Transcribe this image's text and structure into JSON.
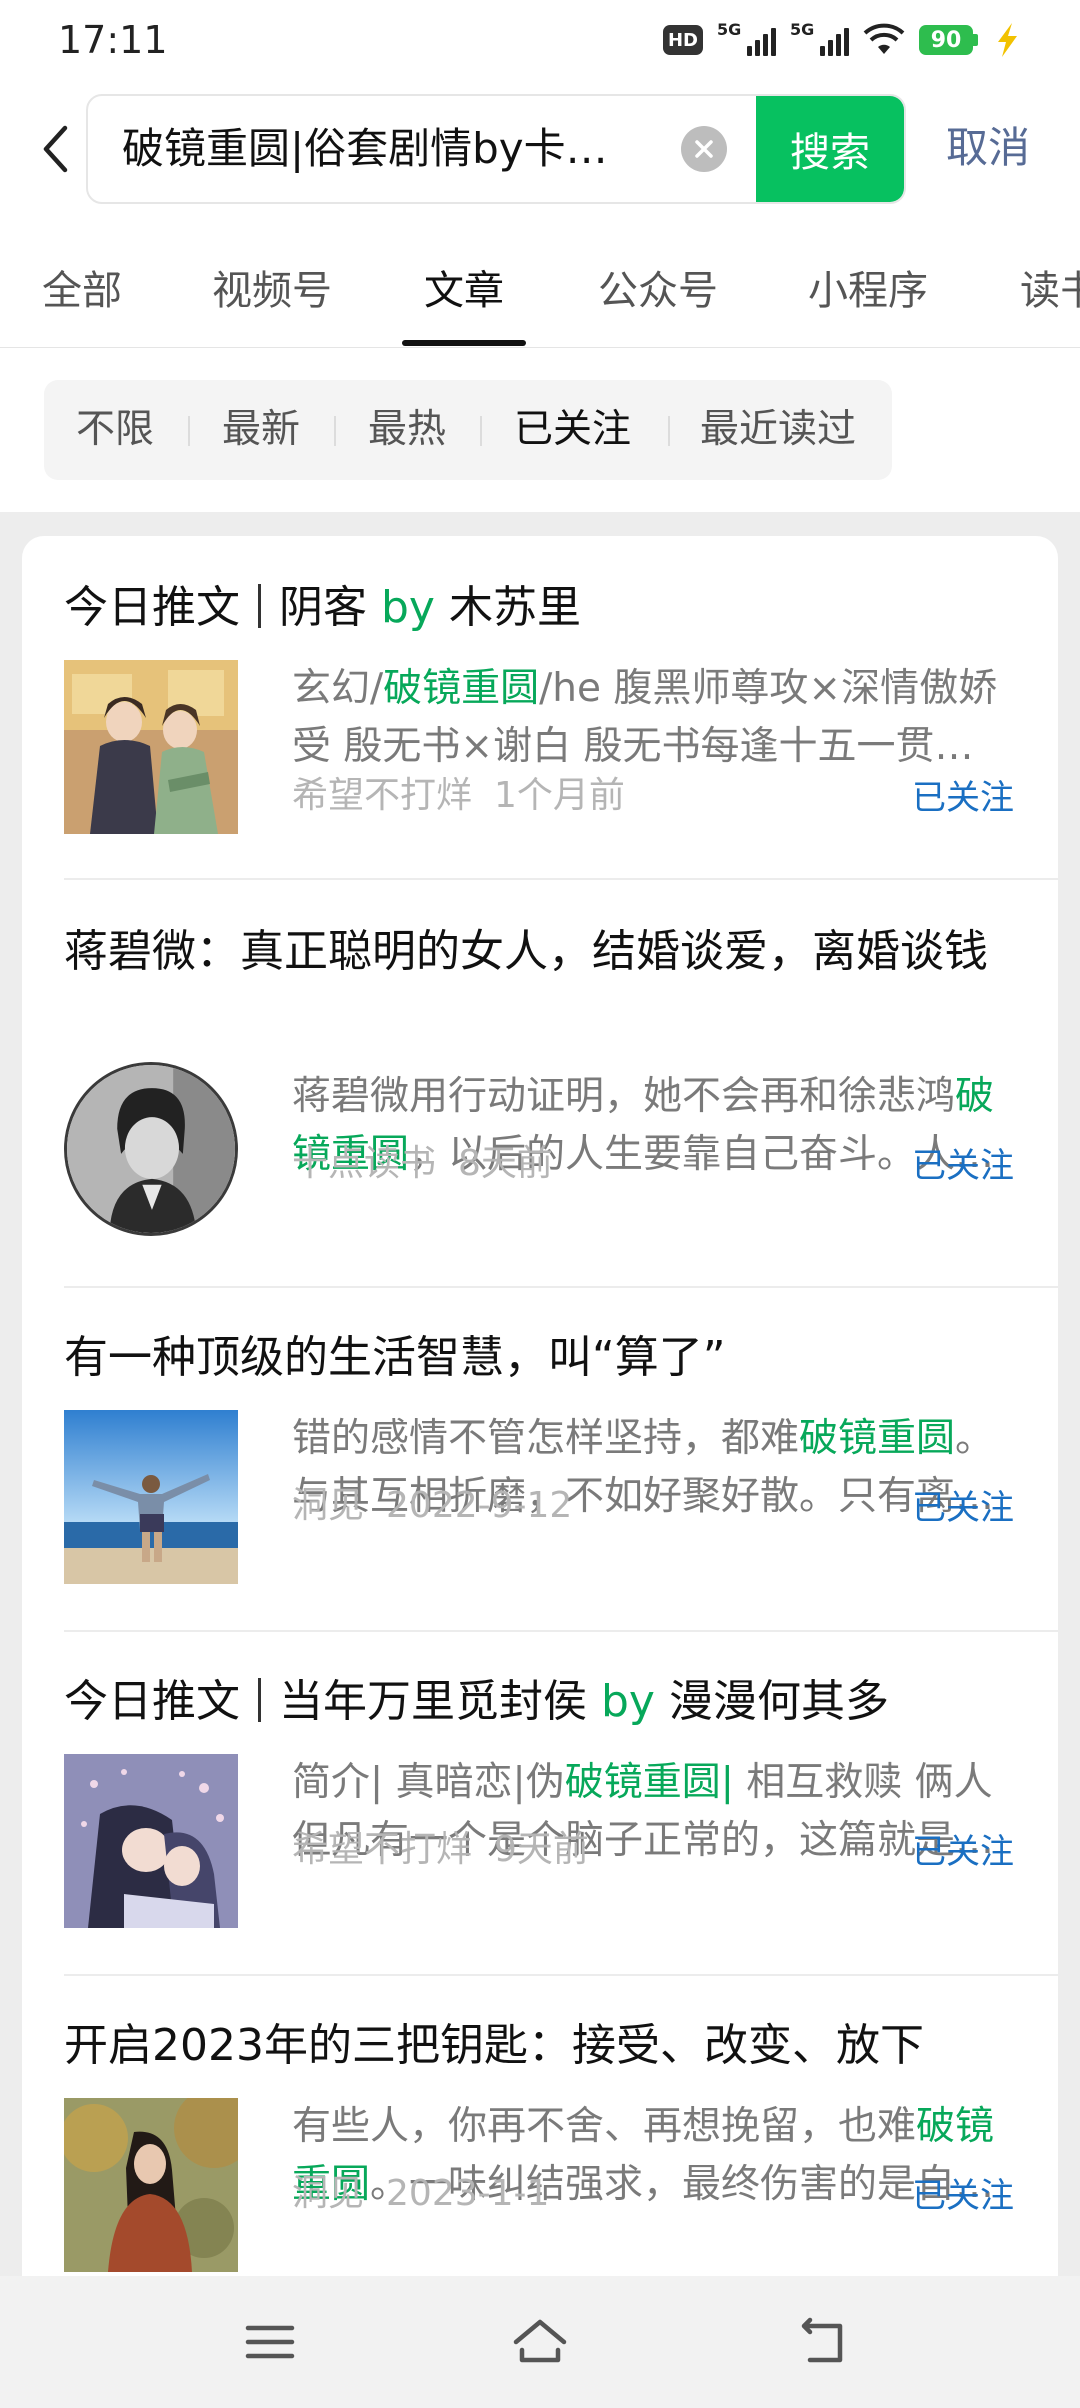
{
  "status_bar": {
    "time": "17:11",
    "network_badge": "HD",
    "sim1_label": "5G",
    "sim2_label": "5G",
    "battery": "90",
    "battery_color": "#2ebd4e",
    "icons": [
      "hd-icon",
      "signal-icon",
      "signal-icon",
      "wifi-icon",
      "battery-icon",
      "charging-bolt-icon"
    ]
  },
  "search": {
    "query": "破镜重圆|俗套剧情by卡…",
    "search_button": "搜索",
    "cancel": "取消",
    "accent": "#07c160",
    "link_color": "#576b95"
  },
  "tabs": [
    {
      "label": "全部"
    },
    {
      "label": "视频号"
    },
    {
      "label": "文章",
      "active": true
    },
    {
      "label": "公众号"
    },
    {
      "label": "小程序"
    },
    {
      "label": "读书"
    }
  ],
  "filters": [
    {
      "label": "不限"
    },
    {
      "label": "最新"
    },
    {
      "label": "最热"
    },
    {
      "label": "已关注",
      "active": true
    },
    {
      "label": "最近读过"
    }
  ],
  "articles": [
    {
      "title_parts": [
        "今日推文",
        "阴客 ",
        "by",
        " 木苏里"
      ],
      "snippet_line1": [
        "玄幻/",
        "破镜重圆",
        "/he 腹黑师尊攻×深情傲娇"
      ],
      "snippet_line2": "受 殷无书×谢白 殷无书每逢十五一贯…",
      "source": "希望不打烊",
      "date": "1个月前",
      "follow": "已关注",
      "thumb": "illustration-two-men"
    },
    {
      "title": "蒋碧微：真正聪明的女人，结婚谈爱，离婚谈钱",
      "snippet_line1": [
        "蒋碧微用行动证明，她不会再和徐悲鸿",
        "破"
      ],
      "snippet_line2": [
        "镜重圆",
        "，以后的人生要靠自己奋斗。人…"
      ],
      "source": "十点读书",
      "date": "8天前",
      "follow": "已关注",
      "thumb": "portrait-woman"
    },
    {
      "title": "有一种顶级的生活智慧，叫“算了”",
      "snippet_line1": [
        "错的感情不管怎样坚持，都难",
        "破镜重圆",
        "。"
      ],
      "snippet_line2": "与其互相折磨，不如好聚好散。只有离…",
      "source": "洞见",
      "date": "2022-9-12",
      "follow": "已关注",
      "thumb": "person-on-beach"
    },
    {
      "title_parts": [
        "今日推文",
        "当年万里觅封侯 ",
        "by",
        " 漫漫何其多"
      ],
      "snippet_line1": [
        "简介| 真暗恋|伪",
        "破镜重圆|",
        " 相互救赎 俩人"
      ],
      "snippet_line2": "但凡有一个是个脑子正常的，这篇就是…",
      "source": "希望不打烊",
      "date": "9天前",
      "follow": "已关注",
      "thumb": "illustration-couple"
    },
    {
      "title": "开启2023年的三把钥匙：接受、改变、放下",
      "snippet_line1": [
        "有些人，你再不舍、再想挽留，也难",
        "破镜"
      ],
      "snippet_line2": [
        "重圆",
        "。一味纠结强求，最终伤害的是自…"
      ],
      "source": "洞见",
      "date": "2023-1-1",
      "follow": "已关注",
      "thumb": "woman-in-autumn"
    }
  ],
  "nav": {
    "icons": [
      "menu-icon",
      "home-icon",
      "back-icon"
    ]
  }
}
